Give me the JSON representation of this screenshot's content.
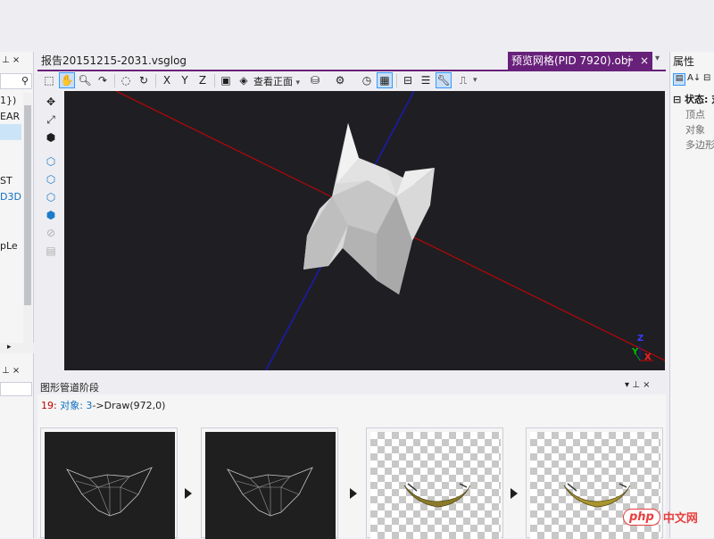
{
  "left_panel": {
    "pin_glyphs": "⊥ ×",
    "fragments": [
      "1})",
      "EAR",
      "ST",
      "D3D",
      "pLe"
    ],
    "bottom_pin_glyphs": "⊥ ×"
  },
  "document": {
    "tab_label": "报告20151215-2031.vsglog",
    "active_tab_label": "预览网格(PID 7920).obj",
    "active_tab_pin": "⊸",
    "active_tab_close": "×",
    "dropdown": "▾"
  },
  "toolbar": {
    "view_dropdown_label": "查看正面",
    "icons": [
      "select-icon",
      "pan-icon",
      "zoom-icon",
      "rotate-icon",
      "orbit-icon",
      "flip-x-icon",
      "flip-y-icon",
      "flip-z-icon",
      "frame-icon",
      "object-icon",
      "view-front-icon",
      "cylinder-icon",
      "lighting-icon",
      "history-icon",
      "grid-icon",
      "toolbox-icon",
      "list-icon",
      "wrench-icon",
      "stamp-icon"
    ]
  },
  "properties": {
    "title": "属性",
    "pin_glyphs": "⊥ ×",
    "section": "状态: 对",
    "rows": [
      "顶点",
      "对象",
      "多边形"
    ]
  },
  "pipeline": {
    "title": "图形管道阶段",
    "pin_glyphs": "▾ ⊥ ×",
    "event_number": "19:",
    "event_object": "对象: 3",
    "event_call": "->Draw(972,0)"
  },
  "viewport": {
    "axis_labels": {
      "z": "Z",
      "y": "Y",
      "x": "X"
    },
    "colors": {
      "x_axis": "#D40000",
      "y_axis": "#00A000",
      "z_axis": "#1A1AB4",
      "background": "#1F1F23"
    }
  },
  "watermark": {
    "logo": "php",
    "text": "中文网"
  }
}
